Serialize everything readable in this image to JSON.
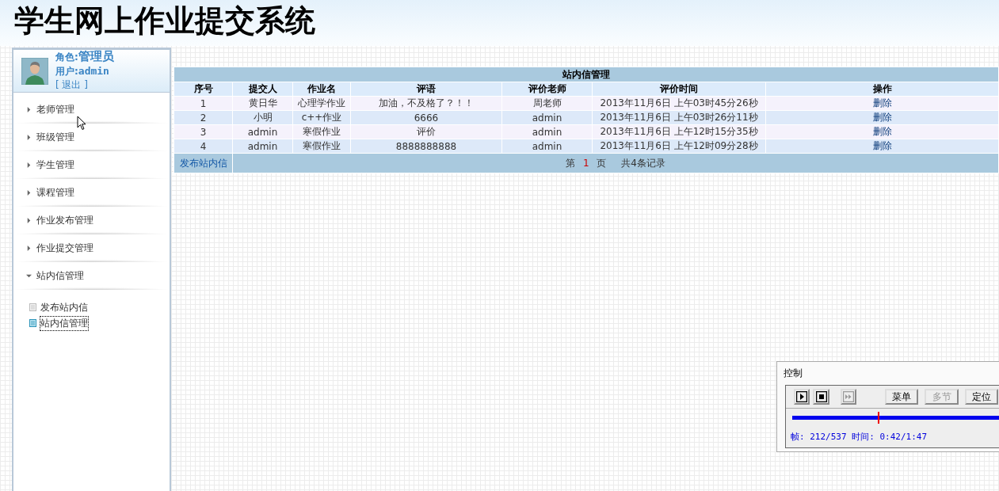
{
  "header": {
    "title": "学生网上作业提交系统"
  },
  "profile": {
    "role_label": "角色:",
    "role": "管理员",
    "user_label": "用户:",
    "user": "admin",
    "logout": "[ 退出 ]"
  },
  "sidebar": {
    "items": [
      {
        "label": "老师管理",
        "expanded": false
      },
      {
        "label": "班级管理",
        "expanded": false
      },
      {
        "label": "学生管理",
        "expanded": false
      },
      {
        "label": "课程管理",
        "expanded": false
      },
      {
        "label": "作业发布管理",
        "expanded": false
      },
      {
        "label": "作业提交管理",
        "expanded": false
      },
      {
        "label": "站内信管理",
        "expanded": true,
        "children": [
          {
            "label": "发布站内信",
            "selected": false
          },
          {
            "label": "站内信管理",
            "selected": true
          }
        ]
      }
    ]
  },
  "table": {
    "title": "站内信管理",
    "columns": [
      "序号",
      "提交人",
      "作业名",
      "评语",
      "评价老师",
      "评价时间",
      "操作"
    ],
    "rows": [
      [
        "1",
        "黄日华",
        "心理学作业",
        "加油，不及格了？！！",
        "周老师",
        "2013年11月6日 上午03时45分26秒",
        "删除"
      ],
      [
        "2",
        "小明",
        "c++作业",
        "6666",
        "admin",
        "2013年11月6日 上午03时26分11秒",
        "删除"
      ],
      [
        "3",
        "admin",
        "寒假作业",
        "评价",
        "admin",
        "2013年11月6日 上午12时15分35秒",
        "删除"
      ],
      [
        "4",
        "admin",
        "寒假作业",
        "8888888888",
        "admin",
        "2013年11月6日 上午12时09分28秒",
        "删除"
      ]
    ],
    "footer_link": "发布站内信",
    "page_label": "第",
    "page": "1",
    "page_suffix": "页",
    "total": "共4条记录"
  },
  "player": {
    "title": "控制",
    "buttons": [
      {
        "kind": "play",
        "disabled": false
      },
      {
        "kind": "stop",
        "disabled": false
      },
      {
        "kind": "step",
        "disabled": true
      },
      {
        "kind": "text",
        "label": "菜单",
        "disabled": false
      },
      {
        "kind": "text",
        "label": "多节",
        "disabled": true
      },
      {
        "kind": "text",
        "label": "定位",
        "disabled": false
      }
    ],
    "level": 0.4,
    "status": "帧: 212/537 时间: 0:42/1:47"
  }
}
